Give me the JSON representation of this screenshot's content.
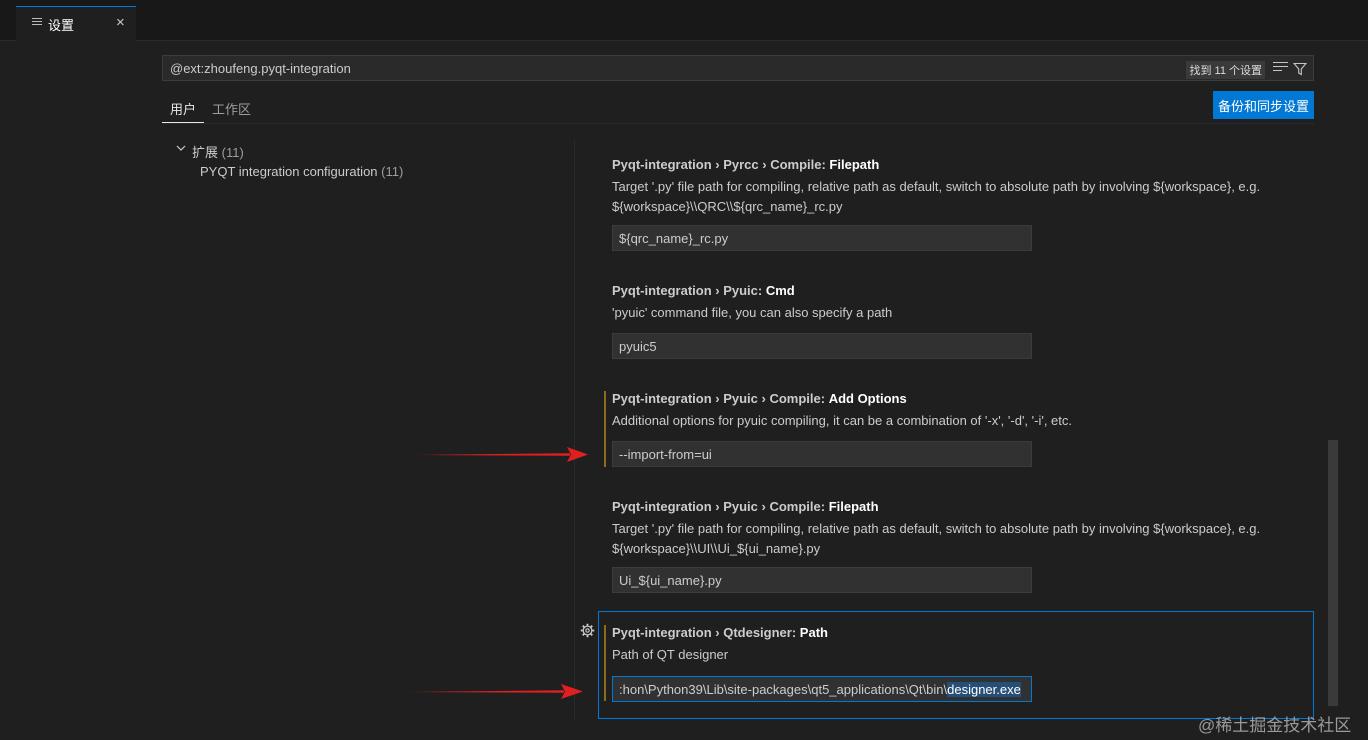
{
  "tab": {
    "label": "设置",
    "close_glyph": "×"
  },
  "search": {
    "value": "@ext:zhoufeng.pyqt-integration",
    "result_count": "找到 11 个设置"
  },
  "scope_tabs": {
    "user": "用户",
    "workspace": "工作区"
  },
  "sync_button": "备份和同步设置",
  "toc": {
    "extensions_label": "扩展",
    "extensions_count": "(11)",
    "group_label": "PYQT integration configuration",
    "group_count": "(11)"
  },
  "settings": [
    {
      "prefix": "Pyqt-integration › Pyrcc › Compile: ",
      "name": "Filepath",
      "desc1": "Target '.py' file path for compiling, relative path as default, switch to absolute path by involving ${workspace}, e.g.",
      "desc2": "${workspace}\\\\QRC\\\\${qrc_name}_rc.py",
      "value": "${qrc_name}_rc.py"
    },
    {
      "prefix": "Pyqt-integration › Pyuic: ",
      "name": "Cmd",
      "desc1": "'pyuic' command file, you can also specify a path",
      "value": "pyuic5"
    },
    {
      "prefix": "Pyqt-integration › Pyuic › Compile: ",
      "name": "Add Options",
      "desc1": "Additional options for pyuic compiling, it can be a combination of '-x', '-d', '-i', etc.",
      "value": "--import-from=ui"
    },
    {
      "prefix": "Pyqt-integration › Pyuic › Compile: ",
      "name": "Filepath",
      "desc1": "Target '.py' file path for compiling, relative path as default, switch to absolute path by involving ${workspace}, e.g.",
      "desc2": "${workspace}\\\\UI\\\\Ui_${ui_name}.py",
      "value": "Ui_${ui_name}.py"
    },
    {
      "prefix": "Pyqt-integration › Qtdesigner: ",
      "name": "Path",
      "desc1": "Path of QT designer",
      "value_visible": ":hon\\Python39\\Lib\\site-packages\\qt5_applications\\Qt\\bin\\",
      "value_selected": "designer.exe"
    }
  ],
  "watermark": "@稀土掘金技术社区",
  "colors": {
    "accent": "#0078d4",
    "modified": "#8c6b1d",
    "annotation_arrow": "#e02020",
    "background": "#1f1f1f"
  },
  "icons": [
    "settings-file-icon",
    "close-icon",
    "clear-filters-icon",
    "filter-icon",
    "chevron-down-icon",
    "gear-icon"
  ]
}
